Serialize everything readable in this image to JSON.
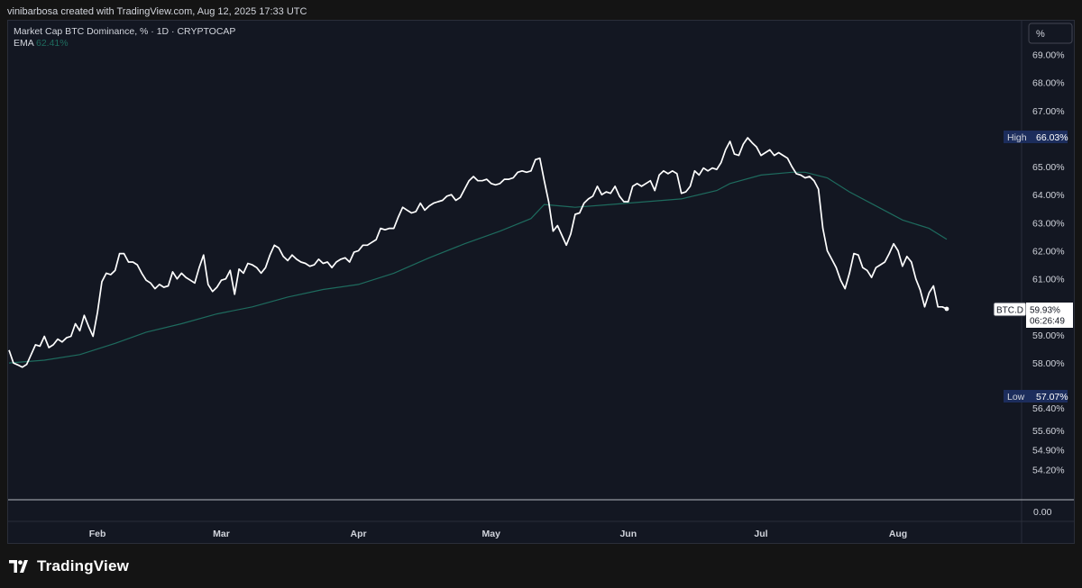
{
  "header": {
    "attribution": "vinibarbosa created with TradingView.com, Aug 12, 2025 17:33 UTC"
  },
  "legend": {
    "title": "Market Cap BTC Dominance, % · 1D · CRYPTOCAP",
    "ema_label": "EMA",
    "ema_value": "62.41%"
  },
  "scale_button": {
    "label": "%"
  },
  "footer": {
    "brand": "TradingView"
  },
  "colors": {
    "background": "#131722",
    "price_line": "#ffffff",
    "ema_line": "#1e6b5e",
    "high_low_tag": "#1c2d5c",
    "axis_text": "#d1d4dc"
  },
  "chart_data": {
    "type": "line",
    "symbol": "BTC.D",
    "last_value": "59.93%",
    "countdown": "06:26:49",
    "high": {
      "label": "High",
      "value": "66.03%"
    },
    "low": {
      "label": "Low",
      "value": "57.07%"
    },
    "y_ticks": [
      "69.00%",
      "68.00%",
      "67.00%",
      "65.00%",
      "64.00%",
      "63.00%",
      "62.00%",
      "61.00%",
      "59.00%",
      "58.00%",
      "56.40%",
      "55.60%",
      "54.90%",
      "54.20%"
    ],
    "volume_pane_tick": "0.00",
    "x_ticks": [
      "Feb",
      "Mar",
      "Apr",
      "May",
      "Jun",
      "Jul",
      "Aug"
    ],
    "series": [
      {
        "id": "price",
        "values": [
          [
            "2025-01-12",
            58.46
          ],
          [
            "2025-01-13",
            58.0
          ],
          [
            "2025-01-14",
            57.93
          ],
          [
            "2025-01-15",
            57.85
          ],
          [
            "2025-01-16",
            57.95
          ],
          [
            "2025-01-17",
            58.3
          ],
          [
            "2025-01-18",
            58.65
          ],
          [
            "2025-01-19",
            58.6
          ],
          [
            "2025-01-20",
            58.95
          ],
          [
            "2025-01-21",
            58.55
          ],
          [
            "2025-01-22",
            58.65
          ],
          [
            "2025-01-23",
            58.85
          ],
          [
            "2025-01-24",
            58.75
          ],
          [
            "2025-01-25",
            58.9
          ],
          [
            "2025-01-26",
            58.95
          ],
          [
            "2025-01-27",
            59.4
          ],
          [
            "2025-01-28",
            59.15
          ],
          [
            "2025-01-29",
            59.7
          ],
          [
            "2025-01-30",
            59.3
          ],
          [
            "2025-01-31",
            58.95
          ],
          [
            "2025-02-01",
            59.8
          ],
          [
            "2025-02-02",
            60.9
          ],
          [
            "2025-02-03",
            61.2
          ],
          [
            "2025-02-04",
            61.15
          ],
          [
            "2025-02-05",
            61.3
          ],
          [
            "2025-02-06",
            61.9
          ],
          [
            "2025-02-07",
            61.9
          ],
          [
            "2025-02-08",
            61.6
          ],
          [
            "2025-02-09",
            61.6
          ],
          [
            "2025-02-10",
            61.5
          ],
          [
            "2025-02-11",
            61.2
          ],
          [
            "2025-02-12",
            60.95
          ],
          [
            "2025-02-13",
            60.85
          ],
          [
            "2025-02-14",
            60.65
          ],
          [
            "2025-02-15",
            60.8
          ],
          [
            "2025-02-16",
            60.7
          ],
          [
            "2025-02-17",
            60.75
          ],
          [
            "2025-02-18",
            61.25
          ],
          [
            "2025-02-19",
            61.0
          ],
          [
            "2025-02-20",
            61.2
          ],
          [
            "2025-02-21",
            61.05
          ],
          [
            "2025-02-22",
            60.95
          ],
          [
            "2025-02-23",
            60.85
          ],
          [
            "2025-02-24",
            61.4
          ],
          [
            "2025-02-25",
            61.85
          ],
          [
            "2025-02-26",
            60.8
          ],
          [
            "2025-02-27",
            60.55
          ],
          [
            "2025-02-28",
            60.7
          ],
          [
            "2025-03-01",
            60.95
          ],
          [
            "2025-03-02",
            61.0
          ],
          [
            "2025-03-03",
            61.3
          ],
          [
            "2025-03-04",
            60.45
          ],
          [
            "2025-03-05",
            61.35
          ],
          [
            "2025-03-06",
            61.2
          ],
          [
            "2025-03-07",
            61.55
          ],
          [
            "2025-03-08",
            61.5
          ],
          [
            "2025-03-09",
            61.4
          ],
          [
            "2025-03-10",
            61.2
          ],
          [
            "2025-03-11",
            61.4
          ],
          [
            "2025-03-12",
            61.85
          ],
          [
            "2025-03-13",
            62.2
          ],
          [
            "2025-03-14",
            62.1
          ],
          [
            "2025-03-15",
            61.8
          ],
          [
            "2025-03-16",
            61.65
          ],
          [
            "2025-03-17",
            61.85
          ],
          [
            "2025-03-18",
            61.7
          ],
          [
            "2025-03-19",
            61.6
          ],
          [
            "2025-03-20",
            61.55
          ],
          [
            "2025-03-21",
            61.45
          ],
          [
            "2025-03-22",
            61.5
          ],
          [
            "2025-03-23",
            61.7
          ],
          [
            "2025-03-24",
            61.55
          ],
          [
            "2025-03-25",
            61.6
          ],
          [
            "2025-03-26",
            61.4
          ],
          [
            "2025-03-27",
            61.6
          ],
          [
            "2025-03-28",
            61.7
          ],
          [
            "2025-03-29",
            61.75
          ],
          [
            "2025-03-30",
            61.6
          ],
          [
            "2025-03-31",
            61.95
          ],
          [
            "2025-04-01",
            62.0
          ],
          [
            "2025-04-02",
            62.2
          ],
          [
            "2025-04-03",
            62.2
          ],
          [
            "2025-04-04",
            62.3
          ],
          [
            "2025-04-05",
            62.4
          ],
          [
            "2025-04-06",
            62.8
          ],
          [
            "2025-04-07",
            62.75
          ],
          [
            "2025-04-08",
            62.8
          ],
          [
            "2025-04-09",
            62.8
          ],
          [
            "2025-04-10",
            63.2
          ],
          [
            "2025-04-11",
            63.55
          ],
          [
            "2025-04-12",
            63.45
          ],
          [
            "2025-04-13",
            63.35
          ],
          [
            "2025-04-14",
            63.4
          ],
          [
            "2025-04-15",
            63.7
          ],
          [
            "2025-04-16",
            63.45
          ],
          [
            "2025-04-17",
            63.6
          ],
          [
            "2025-04-18",
            63.7
          ],
          [
            "2025-04-19",
            63.75
          ],
          [
            "2025-04-20",
            63.8
          ],
          [
            "2025-04-21",
            63.95
          ],
          [
            "2025-04-22",
            64.0
          ],
          [
            "2025-04-23",
            63.8
          ],
          [
            "2025-04-24",
            63.9
          ],
          [
            "2025-04-25",
            64.2
          ],
          [
            "2025-04-26",
            64.5
          ],
          [
            "2025-04-27",
            64.65
          ],
          [
            "2025-04-28",
            64.5
          ],
          [
            "2025-04-29",
            64.5
          ],
          [
            "2025-04-30",
            64.55
          ],
          [
            "2025-05-01",
            64.4
          ],
          [
            "2025-05-02",
            64.35
          ],
          [
            "2025-05-03",
            64.4
          ],
          [
            "2025-05-04",
            64.55
          ],
          [
            "2025-05-05",
            64.55
          ],
          [
            "2025-05-06",
            64.6
          ],
          [
            "2025-05-07",
            64.8
          ],
          [
            "2025-05-08",
            64.85
          ],
          [
            "2025-05-09",
            64.8
          ],
          [
            "2025-05-10",
            64.85
          ],
          [
            "2025-05-11",
            65.25
          ],
          [
            "2025-05-12",
            65.3
          ],
          [
            "2025-05-13",
            64.5
          ],
          [
            "2025-05-14",
            63.75
          ],
          [
            "2025-05-15",
            62.7
          ],
          [
            "2025-05-16",
            62.9
          ],
          [
            "2025-05-17",
            62.55
          ],
          [
            "2025-05-18",
            62.2
          ],
          [
            "2025-05-19",
            62.6
          ],
          [
            "2025-05-20",
            63.3
          ],
          [
            "2025-05-21",
            63.35
          ],
          [
            "2025-05-22",
            63.7
          ],
          [
            "2025-05-23",
            63.85
          ],
          [
            "2025-05-24",
            63.95
          ],
          [
            "2025-05-25",
            64.3
          ],
          [
            "2025-05-26",
            64.0
          ],
          [
            "2025-05-27",
            64.1
          ],
          [
            "2025-05-28",
            64.05
          ],
          [
            "2025-05-29",
            64.3
          ],
          [
            "2025-05-30",
            63.95
          ],
          [
            "2025-05-31",
            63.75
          ],
          [
            "2025-06-01",
            63.75
          ],
          [
            "2025-06-02",
            64.3
          ],
          [
            "2025-06-03",
            64.4
          ],
          [
            "2025-06-04",
            64.3
          ],
          [
            "2025-06-05",
            64.4
          ],
          [
            "2025-06-06",
            64.5
          ],
          [
            "2025-06-07",
            64.15
          ],
          [
            "2025-06-08",
            64.7
          ],
          [
            "2025-06-09",
            64.85
          ],
          [
            "2025-06-10",
            64.75
          ],
          [
            "2025-06-11",
            64.85
          ],
          [
            "2025-06-12",
            64.75
          ],
          [
            "2025-06-13",
            64.05
          ],
          [
            "2025-06-14",
            64.1
          ],
          [
            "2025-06-15",
            64.3
          ],
          [
            "2025-06-16",
            64.85
          ],
          [
            "2025-06-17",
            64.7
          ],
          [
            "2025-06-18",
            64.95
          ],
          [
            "2025-06-19",
            64.85
          ],
          [
            "2025-06-20",
            64.95
          ],
          [
            "2025-06-21",
            64.9
          ],
          [
            "2025-06-22",
            65.15
          ],
          [
            "2025-06-23",
            65.6
          ],
          [
            "2025-06-24",
            65.9
          ],
          [
            "2025-06-25",
            65.45
          ],
          [
            "2025-06-26",
            65.4
          ],
          [
            "2025-06-27",
            65.8
          ],
          [
            "2025-06-28",
            66.03
          ],
          [
            "2025-06-29",
            65.85
          ],
          [
            "2025-06-30",
            65.7
          ],
          [
            "2025-07-01",
            65.4
          ],
          [
            "2025-07-02",
            65.5
          ],
          [
            "2025-07-03",
            65.6
          ],
          [
            "2025-07-04",
            65.4
          ],
          [
            "2025-07-05",
            65.5
          ],
          [
            "2025-07-06",
            65.4
          ],
          [
            "2025-07-07",
            65.3
          ],
          [
            "2025-07-08",
            65.0
          ],
          [
            "2025-07-09",
            64.75
          ],
          [
            "2025-07-10",
            64.7
          ],
          [
            "2025-07-11",
            64.6
          ],
          [
            "2025-07-12",
            64.65
          ],
          [
            "2025-07-13",
            64.5
          ],
          [
            "2025-07-14",
            64.2
          ],
          [
            "2025-07-15",
            62.8
          ],
          [
            "2025-07-16",
            62.0
          ],
          [
            "2025-07-17",
            61.7
          ],
          [
            "2025-07-18",
            61.4
          ],
          [
            "2025-07-19",
            60.95
          ],
          [
            "2025-07-20",
            60.65
          ],
          [
            "2025-07-21",
            61.2
          ],
          [
            "2025-07-22",
            61.9
          ],
          [
            "2025-07-23",
            61.85
          ],
          [
            "2025-07-24",
            61.4
          ],
          [
            "2025-07-25",
            61.3
          ],
          [
            "2025-07-26",
            61.05
          ],
          [
            "2025-07-27",
            61.4
          ],
          [
            "2025-07-28",
            61.5
          ],
          [
            "2025-07-29",
            61.6
          ],
          [
            "2025-07-30",
            61.9
          ],
          [
            "2025-07-31",
            62.25
          ],
          [
            "2025-08-01",
            62.0
          ],
          [
            "2025-08-02",
            61.45
          ],
          [
            "2025-08-03",
            61.8
          ],
          [
            "2025-08-04",
            61.6
          ],
          [
            "2025-08-05",
            61.0
          ],
          [
            "2025-08-06",
            60.6
          ],
          [
            "2025-08-07",
            60.0
          ],
          [
            "2025-08-08",
            60.5
          ],
          [
            "2025-08-09",
            60.75
          ],
          [
            "2025-08-10",
            60.0
          ],
          [
            "2025-08-11",
            60.0
          ],
          [
            "2025-08-12",
            59.93
          ]
        ]
      },
      {
        "id": "ema",
        "values": [
          [
            "2025-01-12",
            58.0
          ],
          [
            "2025-01-20",
            58.1
          ],
          [
            "2025-01-28",
            58.3
          ],
          [
            "2025-02-05",
            58.7
          ],
          [
            "2025-02-12",
            59.1
          ],
          [
            "2025-02-20",
            59.4
          ],
          [
            "2025-02-28",
            59.75
          ],
          [
            "2025-03-08",
            60.0
          ],
          [
            "2025-03-16",
            60.35
          ],
          [
            "2025-03-24",
            60.62
          ],
          [
            "2025-04-01",
            60.8
          ],
          [
            "2025-04-09",
            61.2
          ],
          [
            "2025-04-17",
            61.75
          ],
          [
            "2025-04-25",
            62.25
          ],
          [
            "2025-05-03",
            62.7
          ],
          [
            "2025-05-10",
            63.15
          ],
          [
            "2025-05-13",
            63.65
          ],
          [
            "2025-05-20",
            63.55
          ],
          [
            "2025-05-28",
            63.65
          ],
          [
            "2025-06-05",
            63.75
          ],
          [
            "2025-06-13",
            63.85
          ],
          [
            "2025-06-21",
            64.15
          ],
          [
            "2025-06-24",
            64.4
          ],
          [
            "2025-07-01",
            64.7
          ],
          [
            "2025-07-08",
            64.8
          ],
          [
            "2025-07-11",
            64.8
          ],
          [
            "2025-07-16",
            64.6
          ],
          [
            "2025-07-21",
            64.1
          ],
          [
            "2025-07-27",
            63.6
          ],
          [
            "2025-08-02",
            63.1
          ],
          [
            "2025-08-08",
            62.8
          ],
          [
            "2025-08-12",
            62.41
          ]
        ]
      }
    ]
  }
}
